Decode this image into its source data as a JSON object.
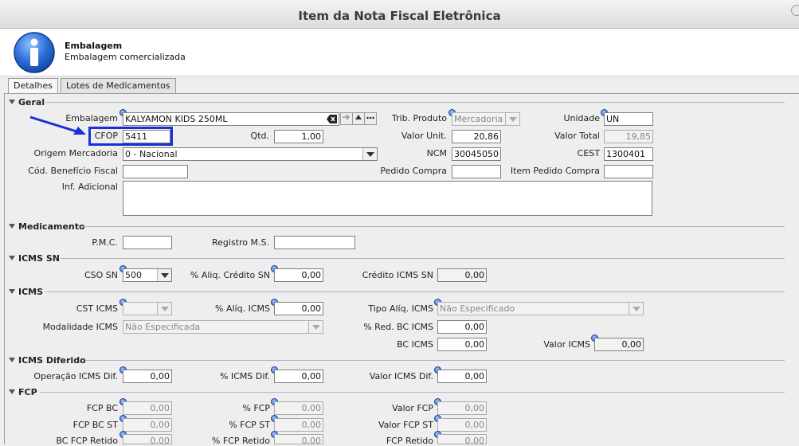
{
  "window": {
    "title": "Item da Nota Fiscal Eletrônica"
  },
  "header": {
    "title": "Embalagem",
    "subtitle": "Embalagem comercializada",
    "icon": "info-icon"
  },
  "tabs": [
    {
      "label": "Detalhes",
      "active": true
    },
    {
      "label": "Lotes de Medicamentos",
      "active": false
    }
  ],
  "sections": {
    "geral": "Geral",
    "medicamento": "Medicamento",
    "icms_sn": "ICMS SN",
    "icms": "ICMS",
    "icms_diferido": "ICMS Diferido",
    "fcp": "FCP"
  },
  "geral": {
    "embalagem": {
      "label": "Embalagem",
      "value": "KALYAMON KIDS 250ML"
    },
    "trib_produto": {
      "label": "Trib. Produto",
      "value": "Mercadoria"
    },
    "unidade": {
      "label": "Unidade",
      "value": "UN"
    },
    "cfop": {
      "label": "CFOP",
      "value": "5411"
    },
    "qtd": {
      "label": "Qtd.",
      "value": "1,00"
    },
    "valor_unit": {
      "label": "Valor Unit.",
      "value": "20,86"
    },
    "valor_total": {
      "label": "Valor Total",
      "value": "19,85"
    },
    "origem": {
      "label": "Origem Mercadoria",
      "value": "0 - Nacional"
    },
    "ncm": {
      "label": "NCM",
      "value": "30045050"
    },
    "cest": {
      "label": "CEST",
      "value": "1300401"
    },
    "cod_beneficio": {
      "label": "Cód. Benefício Fiscal",
      "value": ""
    },
    "pedido_compra": {
      "label": "Pedido Compra",
      "value": ""
    },
    "item_pedido": {
      "label": "Item Pedido Compra",
      "value": ""
    },
    "inf_adicional": {
      "label": "Inf. Adicional",
      "value": ""
    }
  },
  "medicamento": {
    "pmc": {
      "label": "P.M.C.",
      "value": ""
    },
    "registro": {
      "label": "Registro M.S.",
      "value": ""
    }
  },
  "icms_sn": {
    "cso": {
      "label": "CSO SN",
      "value": "500"
    },
    "aliq_credito": {
      "label": "% Aliq. Crédito SN",
      "value": "0,00"
    },
    "credito": {
      "label": "Crédito ICMS SN",
      "value": "0,00"
    }
  },
  "icms": {
    "cst": {
      "label": "CST ICMS",
      "value": ""
    },
    "aliq": {
      "label": "% Alíq. ICMS",
      "value": "0,00"
    },
    "tipo_aliq": {
      "label": "Tipo Alíq. ICMS",
      "value": "Não Especificado"
    },
    "modalidade": {
      "label": "Modalidade ICMS",
      "value": "Não Especificada"
    },
    "red_bc": {
      "label": "% Red. BC ICMS",
      "value": "0,00"
    },
    "bc": {
      "label": "BC ICMS",
      "value": "0,00"
    },
    "valor": {
      "label": "Valor ICMS",
      "value": "0,00"
    }
  },
  "icms_diferido": {
    "operacao": {
      "label": "Operação ICMS Dif.",
      "value": "0,00"
    },
    "perc": {
      "label": "% ICMS Dif.",
      "value": "0,00"
    },
    "valor": {
      "label": "Valor ICMS Dif.",
      "value": "0,00"
    }
  },
  "fcp": {
    "bc": {
      "label": "FCP BC",
      "value": "0,00"
    },
    "perc": {
      "label": "% FCP",
      "value": "0,00"
    },
    "valor": {
      "label": "Valor FCP",
      "value": "0,00"
    },
    "bc_st": {
      "label": "FCP BC ST",
      "value": "0,00"
    },
    "perc_st": {
      "label": "% FCP ST",
      "value": "0,00"
    },
    "valor_st": {
      "label": "Valor FCP ST",
      "value": "0,00"
    },
    "bc_retido": {
      "label": "BC FCP Retido",
      "value": "0,00"
    },
    "perc_retido": {
      "label": "% FCP Retido",
      "value": "0,00"
    },
    "valor_retido": {
      "label": "FCP Retido",
      "value": "0,00"
    }
  },
  "colors": {
    "highlight": "#1a2fd6",
    "arrow": "#1a2fd6",
    "section_line": "#a9b4c2"
  }
}
